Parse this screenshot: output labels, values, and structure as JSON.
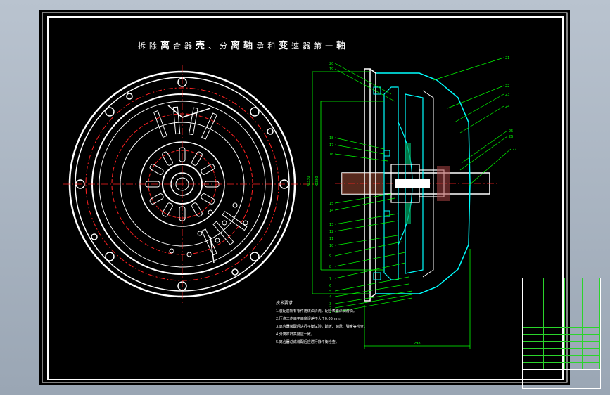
{
  "title": {
    "parts": [
      "拆",
      "除",
      "离",
      "合",
      "器",
      "壳",
      "、",
      "分",
      "离",
      "轴",
      "承",
      "和",
      "变",
      "速",
      "器",
      "第",
      "一",
      "轴"
    ]
  },
  "callouts_right": [
    "21",
    "22",
    "23",
    "24",
    "25",
    "26",
    "27"
  ],
  "callouts_left": [
    "20",
    "19",
    "18",
    "17",
    "16",
    "15",
    "14",
    "13",
    "12",
    "11",
    "10",
    "9",
    "8",
    "7",
    "6",
    "5",
    "4",
    "3",
    "2",
    "1"
  ],
  "dims": {
    "vertical_1": "Φ330",
    "vertical_2": "Φ380",
    "bottom": "298"
  },
  "notes": {
    "heading": "技术要求",
    "lines": [
      "1.装配前所有零件用煤油清洗，配合表面涂润滑油。",
      "2.压盘工作面平面度误差不大于0.05mm。",
      "3.离合器装配后进行平衡试验，踏板、轴承、弹簧等检查。",
      "4.分离杠杆高度应一致。",
      "5.离合器总成装配后应进行静平衡检查。"
    ]
  },
  "colors": {
    "background": "#000000",
    "frame": "#ffffff",
    "dim": "#00ff00",
    "center": "#ff0000",
    "part": "#00ffff",
    "text": "#ffff00"
  }
}
